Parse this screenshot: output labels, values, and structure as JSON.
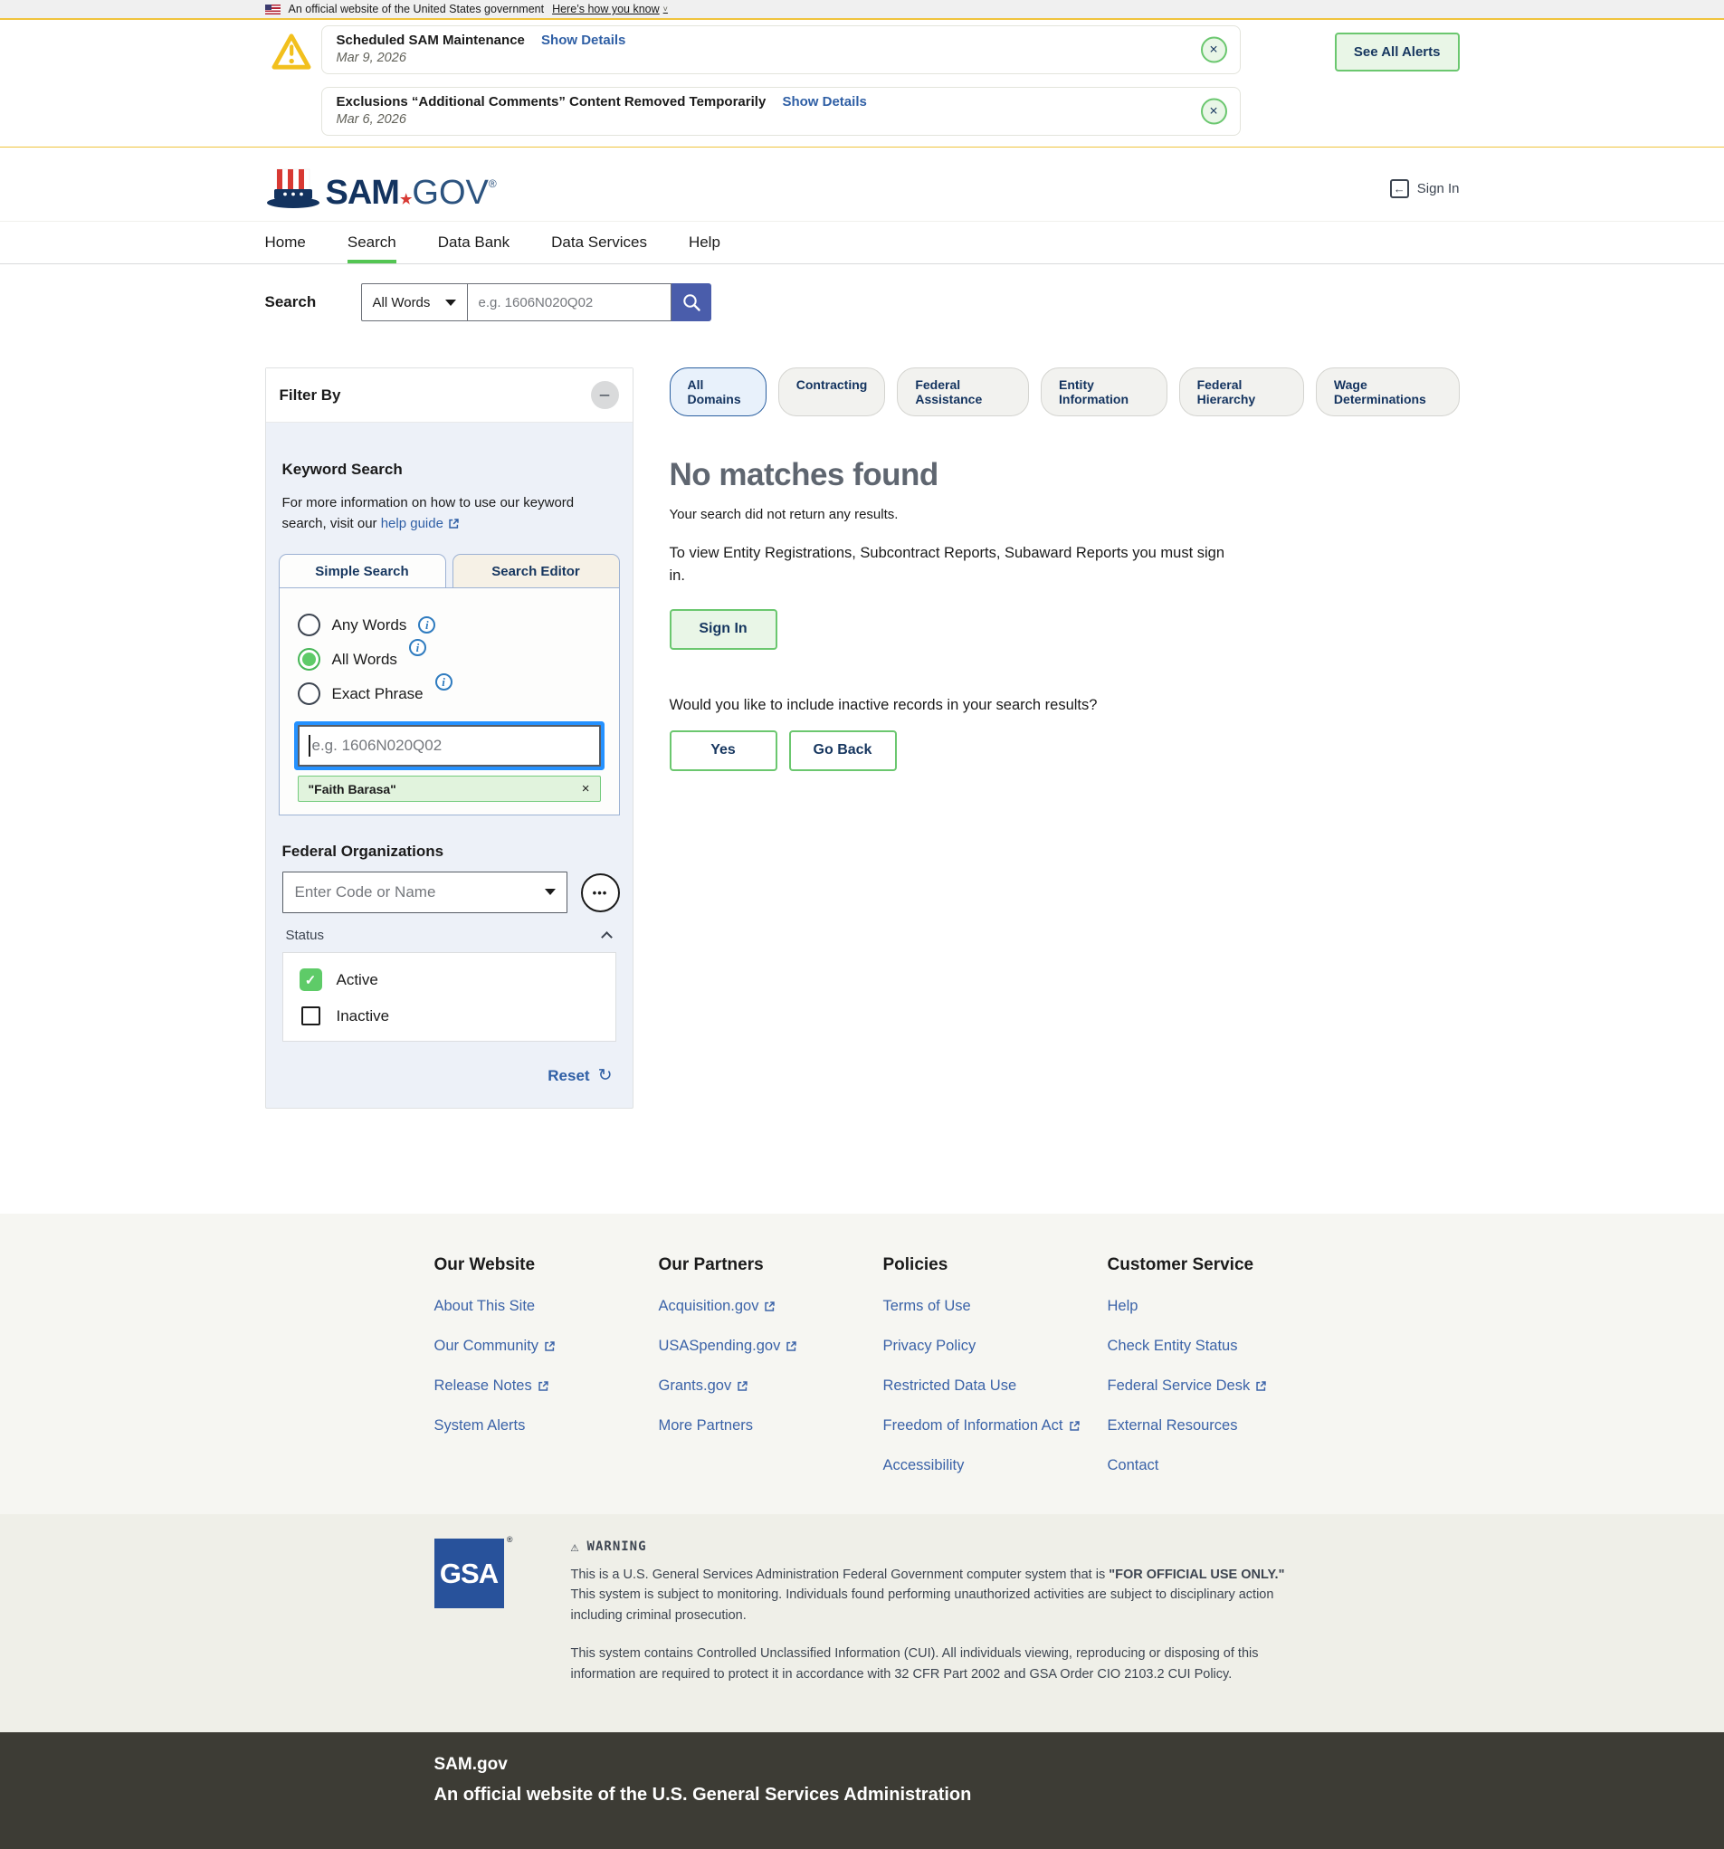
{
  "colors": {
    "accent_green_border": "#6bc76f",
    "accent_green_fill": "#5ecb68",
    "light_green_bg": "#e9f6e7",
    "gold": "#f0c33c",
    "link_blue": "#2f5fa5",
    "footer_link_blue": "#3b63a8",
    "navy_text": "#16365f",
    "search_button_indigo": "#4a5dab",
    "focus_blue": "#2491ff",
    "active_pill_bg": "#e8f1fb",
    "active_pill_border": "#2a5fa0",
    "gsa_blue": "#28529b",
    "dark_footer_bg": "#3d3c35",
    "panel_bg": "#edf1f8"
  },
  "icons": {
    "close": "×",
    "check": "✓",
    "reset": "↻",
    "back_arrow": "←",
    "ellipsis": "•••",
    "minus": "–",
    "info": "i",
    "banner_chevron": "˅",
    "warning_triangle": "⚠",
    "logo_star": "★"
  },
  "gov_banner": {
    "text": "An official website of the United States government",
    "link": "Here’s how you know"
  },
  "alerts": {
    "see_all": "See All Alerts",
    "items": [
      {
        "title": "Scheduled SAM Maintenance",
        "details": "Show Details",
        "date": "Mar 9, 2026"
      },
      {
        "title": "Exclusions “Additional Comments” Content Removed Temporarily",
        "details": "Show Details",
        "date": "Mar 6, 2026"
      }
    ]
  },
  "header": {
    "logo_sam": "SAM",
    "logo_gov": "GOV",
    "logo_reg": "®",
    "sign_in": "Sign In"
  },
  "nav": {
    "items": [
      "Home",
      "Search",
      "Data Bank",
      "Data Services",
      "Help"
    ],
    "active": "Search"
  },
  "search_bar": {
    "label": "Search",
    "selected_mode": "All Words",
    "placeholder": "e.g. 1606N020Q02"
  },
  "filter": {
    "title": "Filter By",
    "keyword_heading": "Keyword Search",
    "keyword_info": "For more information on how to use our keyword search, visit our",
    "help_link": "help guide",
    "tab_simple": "Simple Search",
    "tab_editor": "Search Editor",
    "radio_any": "Any Words",
    "radio_all": "All Words",
    "radio_exact": "Exact Phrase",
    "selected_radio": "All Words",
    "keyword_placeholder": "e.g. 1606N020Q02",
    "chip": "\"Faith Barasa\"",
    "fed_org_heading": "Federal Organizations",
    "fed_org_placeholder": "Enter Code or Name",
    "status_label": "Status",
    "status_active": "Active",
    "status_inactive": "Inactive",
    "active_checked": true,
    "inactive_checked": false,
    "reset": "Reset"
  },
  "results": {
    "domains": [
      "All Domains",
      "Contracting",
      "Federal Assistance",
      "Entity Information",
      "Federal Hierarchy",
      "Wage Determinations"
    ],
    "active_domain": "All Domains",
    "title": "No matches found",
    "subtitle": "Your search did not return any results.",
    "signin_note": "To view Entity Registrations, Subcontract Reports, Subaward Reports you must sign in.",
    "signin_button": "Sign In",
    "inactive_question": "Would you like to include inactive records in your search results?",
    "yes_button": "Yes",
    "go_back_button": "Go Back"
  },
  "footer": {
    "columns": [
      {
        "heading": "Our Website",
        "links": [
          {
            "label": "About This Site",
            "external": false
          },
          {
            "label": "Our Community",
            "external": true
          },
          {
            "label": "Release Notes",
            "external": true
          },
          {
            "label": "System Alerts",
            "external": false
          }
        ]
      },
      {
        "heading": "Our Partners",
        "links": [
          {
            "label": "Acquisition.gov",
            "external": true
          },
          {
            "label": "USASpending.gov",
            "external": true
          },
          {
            "label": "Grants.gov",
            "external": true
          },
          {
            "label": "More Partners",
            "external": false
          }
        ]
      },
      {
        "heading": "Policies",
        "links": [
          {
            "label": "Terms of Use",
            "external": false
          },
          {
            "label": "Privacy Policy",
            "external": false
          },
          {
            "label": "Restricted Data Use",
            "external": false
          },
          {
            "label": "Freedom of Information Act",
            "external": true
          },
          {
            "label": "Accessibility",
            "external": false
          }
        ]
      },
      {
        "heading": "Customer Service",
        "links": [
          {
            "label": "Help",
            "external": false
          },
          {
            "label": "Check Entity Status",
            "external": false
          },
          {
            "label": "Federal Service Desk",
            "external": true
          },
          {
            "label": "External Resources",
            "external": false
          },
          {
            "label": "Contact",
            "external": false
          }
        ]
      }
    ]
  },
  "gsa": {
    "logo": "GSA",
    "reg": "®",
    "warning_label": "WARNING",
    "p1_a": "This is a U.S. General Services Administration Federal Government computer system that is ",
    "p1_b": "\"FOR OFFICIAL USE ONLY.\"",
    "p1_c": " This system is subject to monitoring. Individuals found performing unauthorized activities are subject to disciplinary action including criminal prosecution.",
    "p2": "This system contains Controlled Unclassified Information (CUI). All individuals viewing, reproducing or disposing of this information are required to protect it in accordance with 32 CFR Part 2002 and GSA Order CIO 2103.2 CUI Policy."
  },
  "site_footer": {
    "title": "SAM.gov",
    "subtitle": "An official website of the U.S. General Services Administration"
  }
}
